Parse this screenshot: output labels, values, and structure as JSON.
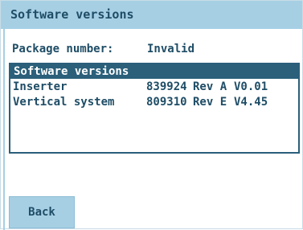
{
  "title": "Software versions",
  "package": {
    "label": "Package number:",
    "value": "Invalid"
  },
  "list": {
    "header": "Software versions",
    "rows": [
      {
        "name": "Inserter",
        "number": "839924",
        "revision": "Rev A",
        "version": "V0.01"
      },
      {
        "name": "Vertical system",
        "number": "809310",
        "revision": "Rev E",
        "version": "V4.45"
      }
    ]
  },
  "buttons": {
    "back_label": "Back"
  }
}
